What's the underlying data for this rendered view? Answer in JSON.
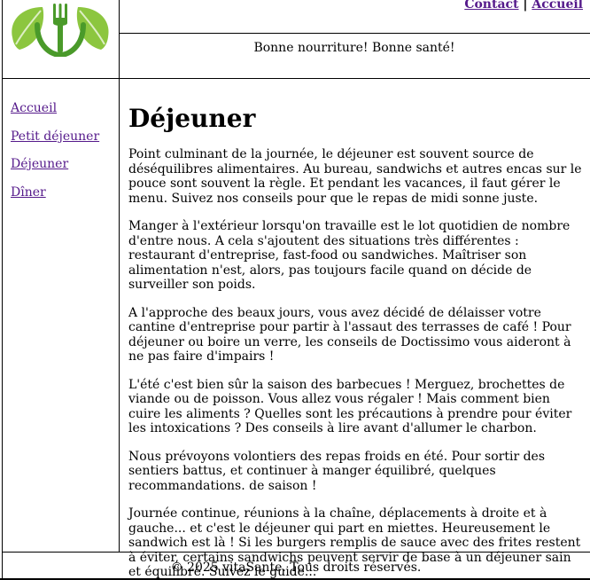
{
  "header": {
    "nav": [
      {
        "label": "Contact"
      },
      {
        "label": "Accueil"
      }
    ],
    "nav_separator": "|",
    "tagline": "Bonne nourriture! Bonne santé!",
    "logo_icon": "fork-and-leaves-logo",
    "logo_colors": [
      "#7cc242",
      "#4a9a2a",
      "#9fd356"
    ]
  },
  "sidebar": {
    "items": [
      {
        "label": "Accueil"
      },
      {
        "label": "Petit déjeuner"
      },
      {
        "label": "Déjeuner"
      },
      {
        "label": "Dîner"
      }
    ]
  },
  "main": {
    "title": "Déjeuner",
    "paragraphs": [
      "Point culminant de la journée, le déjeuner est souvent source de déséquilibres alimentaires. Au bureau, sandwichs et autres encas sur le pouce sont souvent la règle. Et pendant les vacances, il faut gérer le menu. Suivez nos conseils pour que le repas de midi sonne juste.",
      "Manger à l'extérieur lorsqu'on travaille est le lot quotidien de nombre d'entre nous. A cela s'ajoutent des situations très différentes : restaurant d'entreprise, fast-food ou sandwiches. Maîtriser son alimentation n'est, alors, pas toujours facile quand on décide de surveiller son poids.",
      "A l'approche des beaux jours, vous avez décidé de délaisser votre cantine d'entreprise pour partir à l'assaut des terrasses de café ! Pour déjeuner ou boire un verre, les conseils de Doctissimo vous aideront à ne pas faire d'impairs !",
      "L'été c'est bien sûr la saison des barbecues ! Merguez, brochettes de viande ou de poisson. Vous allez vous régaler ! Mais comment bien cuire les aliments ? Quelles sont les précautions à prendre pour éviter les intoxications ? Des conseils à lire avant d'allumer le charbon.",
      "Nous prévoyons volontiers des repas froids en été. Pour sortir des sentiers battus, et continuer à manger équilibré, quelques recommandations. de saison !",
      "Journée continue, réunions à la chaîne, déplacements à droite et à gauche... et c'est le déjeuner qui part en miettes. Heureusement le sandwich est là ! Si les burgers remplis de sauce avec des frites restent à éviter, certains sandwichs peuvent servir de base à un déjeuner sain et équilibré. Suivez le guide..."
    ]
  },
  "footer": {
    "text": "© 2025 vitaSante. Tous droits réservés."
  }
}
